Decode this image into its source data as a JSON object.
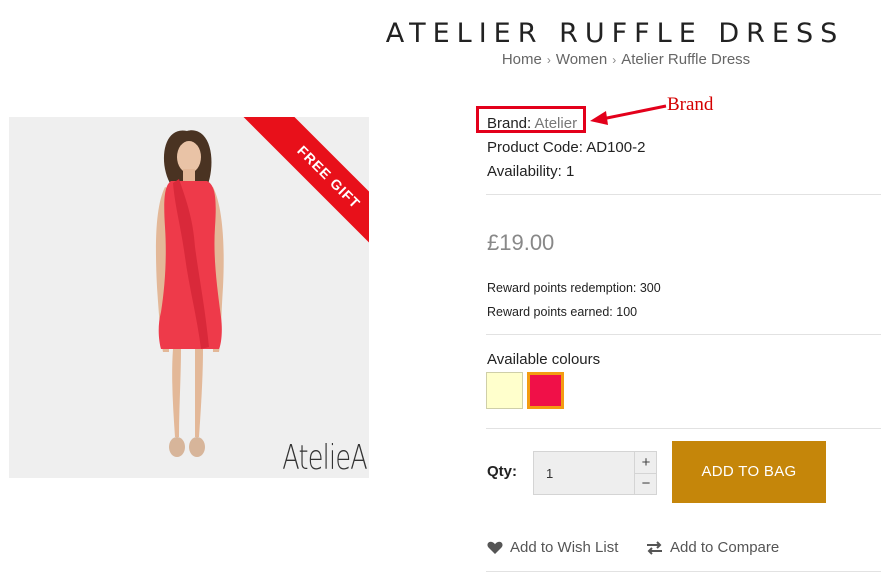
{
  "product": {
    "title": "ATELIER RUFFLE DRESS",
    "breadcrumb": [
      "Home",
      "Women",
      "Atelier Ruffle Dress"
    ],
    "breadcrumb_separator": "›",
    "ribbon": "FREE GIFT",
    "image_logo": "AtelieA",
    "brand_label": "Brand:",
    "brand_value": "Atelier",
    "code_label": "Product Code:",
    "code_value": "AD100-2",
    "availability_label": "Availability:",
    "availability_value": "1",
    "price": "£19.00",
    "reward_redemption": "Reward points redemption: 300",
    "reward_earned": "Reward points earned: 100",
    "colours_label": "Available colours",
    "colours": [
      "#ffffcc",
      "#f01048"
    ],
    "qty_label": "Qty:",
    "qty_value": "1",
    "qty_plus": "+",
    "qty_minus": "−",
    "add_to_bag": "ADD TO BAG",
    "wishlist": "Add to Wish List",
    "compare": "Add to Compare"
  },
  "annotation": {
    "label": "Brand",
    "color": "#e3001b"
  },
  "theme": {
    "accent": "#c5860a",
    "ribbon": "#e8101a",
    "dress": "#ee3a4a"
  }
}
